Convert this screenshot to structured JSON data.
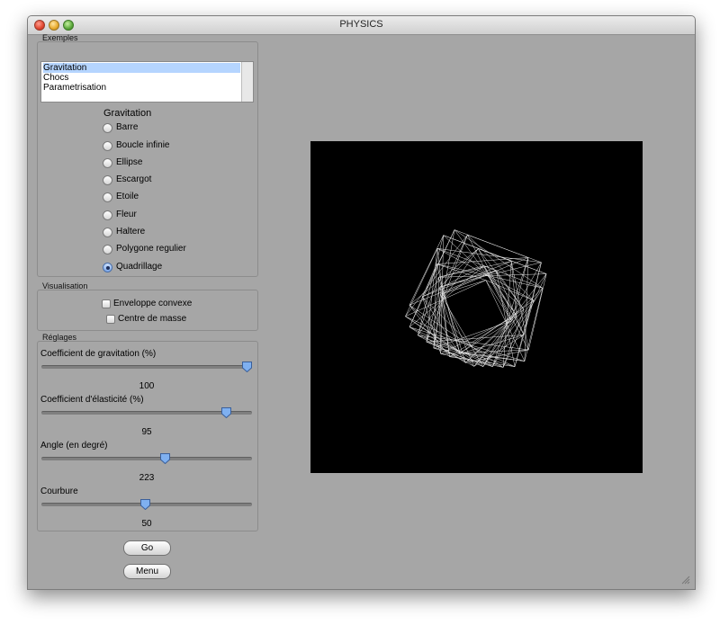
{
  "window": {
    "title": "PHYSICS"
  },
  "examples": {
    "group_label": "Exemples",
    "list": [
      "Gravitation",
      "Chocs",
      "Parametrisation"
    ],
    "selected_index": 0,
    "subtitle": "Gravitation",
    "options": [
      "Barre",
      "Boucle infinie",
      "Ellipse",
      "Escargot",
      "Etoile",
      "Fleur",
      "Haltere",
      "Polygone regulier",
      "Quadrillage"
    ],
    "selected_option": "Quadrillage"
  },
  "visualisation": {
    "group_label": "Visualisation",
    "checkboxes": [
      {
        "label": "Enveloppe convexe",
        "checked": false
      },
      {
        "label": "Centre de masse",
        "checked": false
      }
    ]
  },
  "reglages": {
    "group_label": "Réglages",
    "sliders": [
      {
        "label": "Coefficient de gravitation (%)",
        "value": "100",
        "fraction": 1.0
      },
      {
        "label": "Coefficient d'élasticité (%)",
        "value": "95",
        "fraction": 0.9
      },
      {
        "label": "Angle (en degré)",
        "value": "223",
        "fraction": 0.6
      },
      {
        "label": "Courbure",
        "value": "50",
        "fraction": 0.5
      }
    ]
  },
  "buttons": {
    "go": "Go",
    "menu": "Menu"
  }
}
